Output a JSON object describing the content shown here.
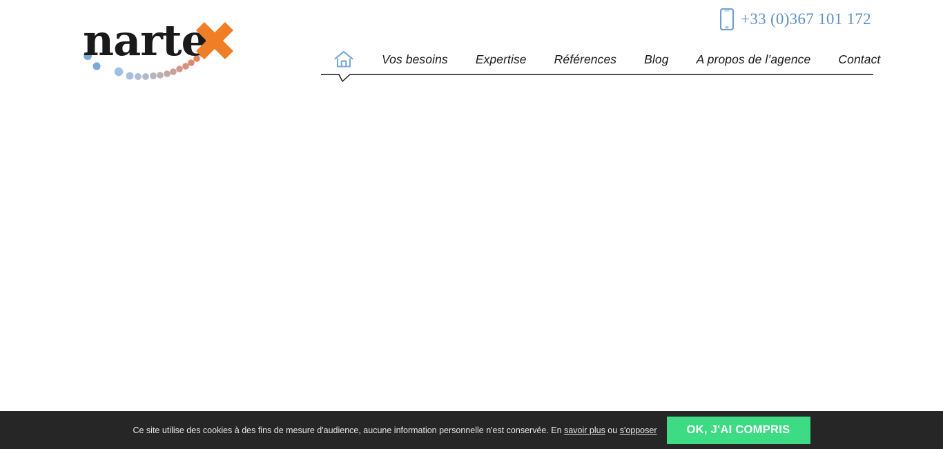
{
  "header": {
    "logo": {
      "name": "nartex-logo",
      "wordmark": "narte",
      "mark": "x",
      "alt": "Nartex",
      "text_color": "#1a1a1a",
      "x_color": "#f07e26",
      "dot_start_color": "#7aa8d8",
      "dot_end_color": "#f07e26"
    },
    "phone": {
      "icon": "mobile-phone-icon",
      "number": "+33 (0)367 101 172",
      "color": "#5e90c6"
    },
    "nav": {
      "home": {
        "icon": "home-icon",
        "label": "Accueil",
        "active": true,
        "color": "#7aa8d8"
      },
      "items": [
        {
          "label": "Vos besoins"
        },
        {
          "label": "Expertise"
        },
        {
          "label": "Références"
        },
        {
          "label": "Blog"
        },
        {
          "label": "A propos de l’agence"
        },
        {
          "label": "Contact"
        }
      ]
    }
  },
  "cookie_banner": {
    "text_before": "Ce site utilise des cookies à des fins de mesure d'audience, aucune information personnelle n'est conservée. En ",
    "link_more": "savoir plus",
    "text_between": " ou ",
    "link_optout": "s'opposer",
    "accept_label": "OK, J'AI COMPRIS",
    "background": "#262626",
    "accept_color": "#3ddc84"
  }
}
